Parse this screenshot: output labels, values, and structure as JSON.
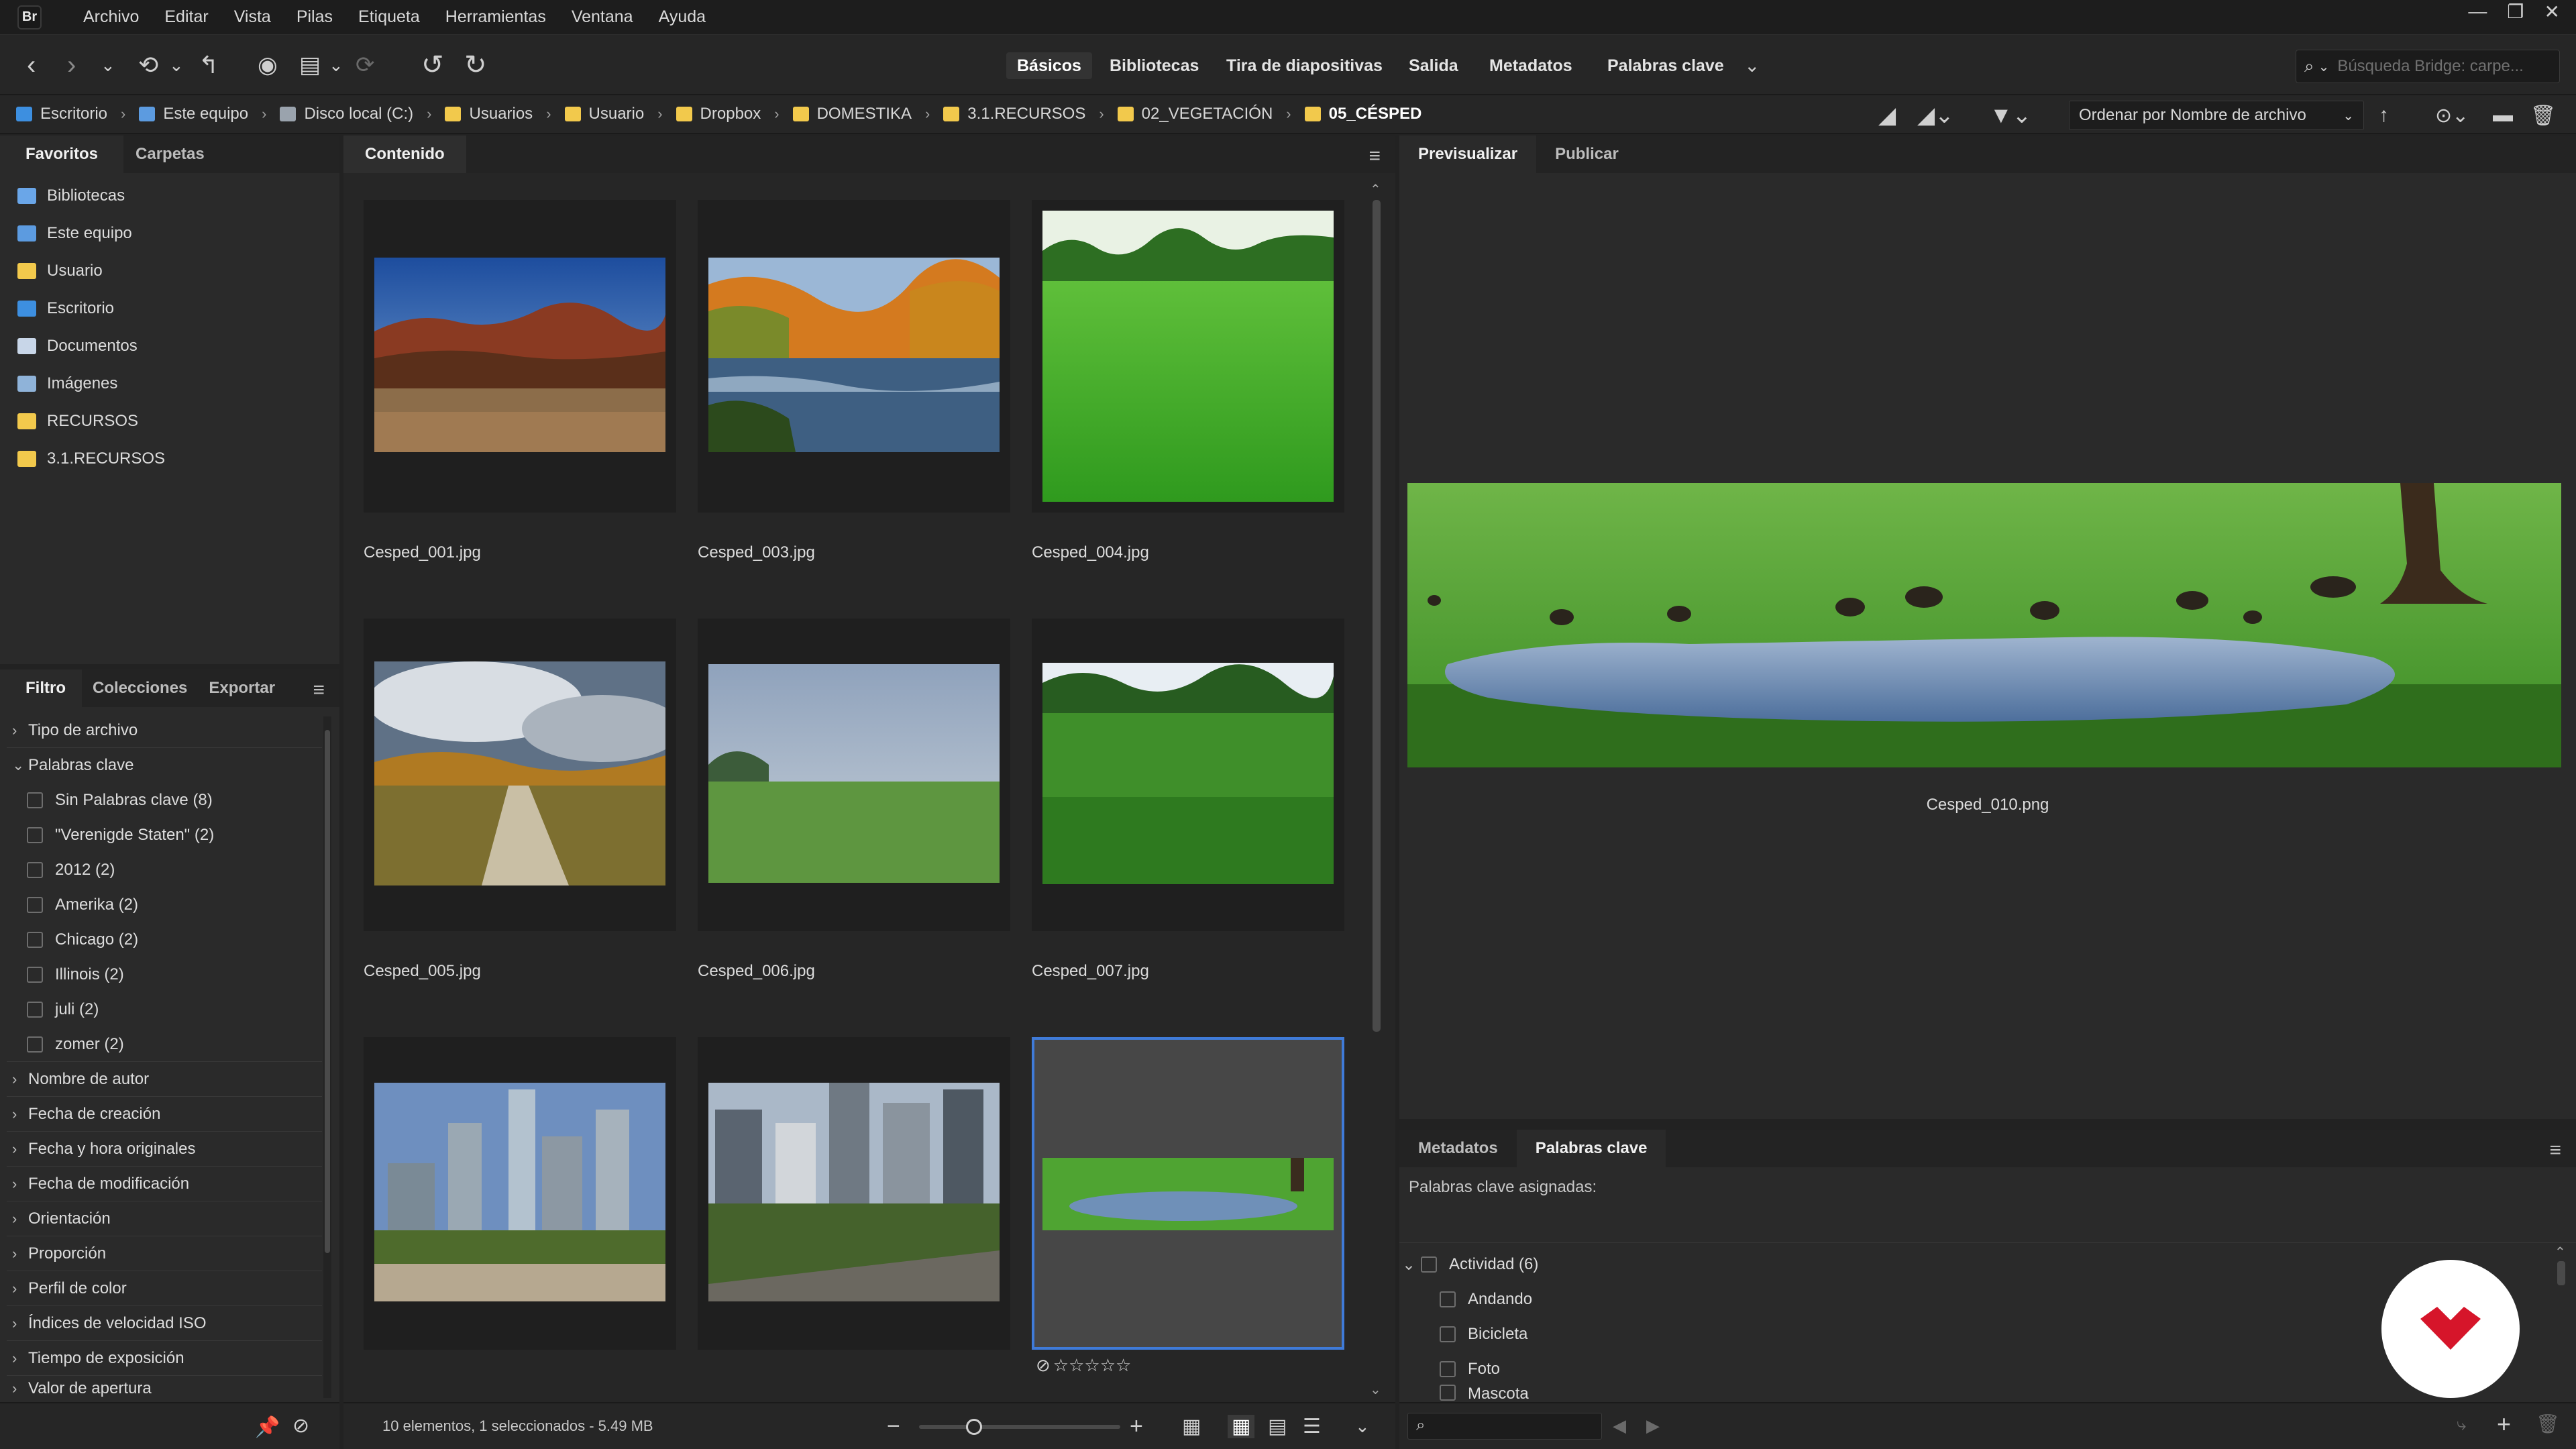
{
  "app": {
    "icon_label": "Br"
  },
  "menu": [
    "Archivo",
    "Editar",
    "Vista",
    "Pilas",
    "Etiqueta",
    "Herramientas",
    "Ventana",
    "Ayuda"
  ],
  "workspaces": {
    "items": [
      "Básicos",
      "Bibliotecas",
      "Tira de diapositivas",
      "Salida",
      "Metadatos",
      "Palabras clave"
    ],
    "active": "Básicos"
  },
  "search": {
    "placeholder": "Búsqueda Bridge: carpe..."
  },
  "path": {
    "crumbs": [
      "Escritorio",
      "Este equipo",
      "Disco local (C:)",
      "Usuarios",
      "Usuario",
      "Dropbox",
      "DOMESTIKA",
      "3.1.RECURSOS",
      "02_VEGETACIÓN",
      "05_CÉSPED"
    ],
    "sort_label": "Ordenar por Nombre de archivo"
  },
  "left_top": {
    "tabs": [
      "Favoritos",
      "Carpetas"
    ],
    "items": [
      {
        "label": "Bibliotecas",
        "icon": "libraries-icon",
        "color": "#6aa6e8"
      },
      {
        "label": "Este equipo",
        "icon": "computer-icon",
        "color": "#5c9be0"
      },
      {
        "label": "Usuario",
        "icon": "folder-icon",
        "color": "#f2c94c"
      },
      {
        "label": "Escritorio",
        "icon": "desktop-folder-icon",
        "color": "#3d8fe0"
      },
      {
        "label": "Documentos",
        "icon": "documents-icon",
        "color": "#c8d6e8"
      },
      {
        "label": "Imágenes",
        "icon": "pictures-icon",
        "color": "#8fb3d9"
      },
      {
        "label": "RECURSOS",
        "icon": "folder-icon",
        "color": "#f2c94c"
      },
      {
        "label": "3.1.RECURSOS",
        "icon": "folder-icon",
        "color": "#f2c94c"
      }
    ]
  },
  "filter": {
    "tabs": [
      "Filtro",
      "Colecciones",
      "Exportar"
    ],
    "tipo_archivo": "Tipo de archivo",
    "palabras_clave": "Palabras clave",
    "keywords": [
      "Sin Palabras clave (8)",
      "\"Verenigde Staten\" (2)",
      "2012 (2)",
      "Amerika (2)",
      "Chicago (2)",
      "Illinois (2)",
      "juli (2)",
      "zomer (2)"
    ],
    "sections": [
      "Nombre de autor",
      "Fecha de creación",
      "Fecha y hora originales",
      "Fecha de modificación",
      "Orientación",
      "Proporción",
      "Perfil de color",
      "Índices de velocidad ISO",
      "Tiempo de exposición",
      "Valor de apertura"
    ]
  },
  "content": {
    "tab": "Contenido",
    "items": [
      {
        "name": "Cesped_001.jpg",
        "selected": false
      },
      {
        "name": "Cesped_003.jpg",
        "selected": false
      },
      {
        "name": "Cesped_004.jpg",
        "selected": false
      },
      {
        "name": "Cesped_005.jpg",
        "selected": false
      },
      {
        "name": "Cesped_006.jpg",
        "selected": false
      },
      {
        "name": "Cesped_007.jpg",
        "selected": false
      },
      {
        "name": "",
        "selected": false
      },
      {
        "name": "",
        "selected": false
      },
      {
        "name": "",
        "selected": true,
        "rating": "☆☆☆☆☆"
      }
    ],
    "status": "10 elementos, 1 seleccionados - 5.49 MB"
  },
  "preview": {
    "tabs": [
      "Previsualizar",
      "Publicar"
    ],
    "caption": "Cesped_010.png"
  },
  "keywords_panel": {
    "tabs": [
      "Metadatos",
      "Palabras clave"
    ],
    "assigned_label": "Palabras clave asignadas:",
    "group": "Actividad (6)",
    "items": [
      "Andando",
      "Bicicleta",
      "Foto",
      "Mascota"
    ]
  }
}
